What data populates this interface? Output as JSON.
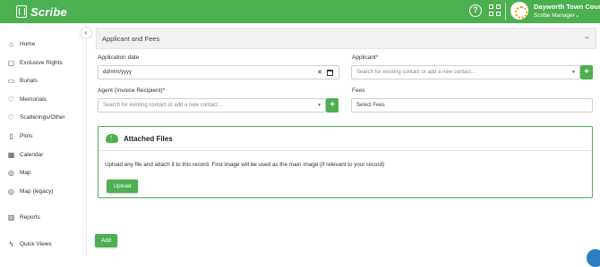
{
  "header": {
    "brand": "Scribe",
    "org_name": "Dayworth Town Council",
    "role": "Scribe Manager"
  },
  "sidebar": {
    "items": [
      {
        "label": "Home",
        "icon": "home-icon"
      },
      {
        "label": "Exclusive Rights",
        "icon": "lock-icon"
      },
      {
        "label": "Burials",
        "icon": "folder-icon"
      },
      {
        "label": "Memorials",
        "icon": "heart-icon"
      },
      {
        "label": "Scatterings/Other",
        "icon": "heart-outline-icon"
      },
      {
        "label": "Plots",
        "icon": "plot-icon"
      },
      {
        "label": "Calendar",
        "icon": "calendar-icon"
      },
      {
        "label": "Map",
        "icon": "map-pin-icon"
      },
      {
        "label": "Map (legacy)",
        "icon": "map-pin-icon"
      },
      {
        "label": "Reports",
        "icon": "bar-chart-icon"
      },
      {
        "label": "Quick Views",
        "icon": "bolt-icon"
      }
    ]
  },
  "panel": {
    "title": "Applicant and Fees",
    "collapse_symbol": "−"
  },
  "form": {
    "application_date_label": "Application date",
    "application_date_value": "dd/mm/yyyy",
    "applicant_label": "Applicant*",
    "applicant_placeholder": "Search for existing contact or add a new contact...",
    "agent_label": "Agent (Invoice Recipient)*",
    "agent_placeholder": "Search for existing contact or add a new contact...",
    "fees_label": "Fees",
    "fees_placeholder": "Select Fees"
  },
  "files": {
    "title": "Attached Files",
    "description": "Upload any file and attach it to this record. First image will be used as the main image (if relevant to your record)",
    "upload_label": "Upload"
  },
  "actions": {
    "add_label": "Add"
  },
  "colors": {
    "accent": "#4caf50",
    "fab": "#2d7fc0"
  }
}
